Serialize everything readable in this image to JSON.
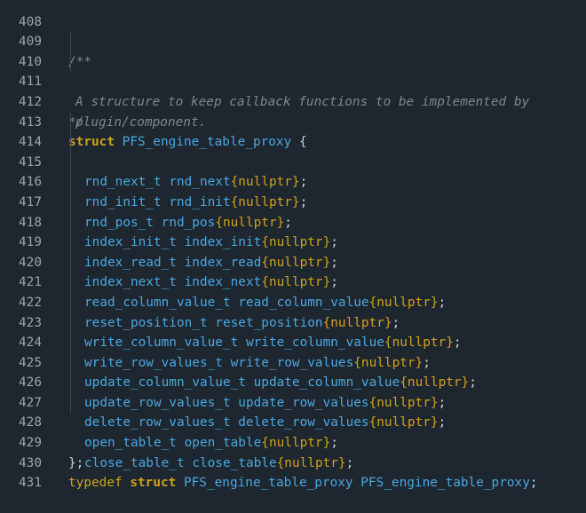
{
  "editor": {
    "lines": [
      {
        "n": "408",
        "kind": "empty"
      },
      {
        "n": "409",
        "kind": "comment",
        "text": "/**"
      },
      {
        "n": "410",
        "kind": "comment-body",
        "text": "A structure to keep callback functions to be implemented by"
      },
      {
        "n": "411",
        "kind": "comment-body",
        "text": "plugin/component."
      },
      {
        "n": "412",
        "kind": "comment",
        "text": "*/"
      },
      {
        "n": "413",
        "kind": "struct-open",
        "keyword": "struct",
        "name": "PFS_engine_table_proxy",
        "brace": "{"
      },
      {
        "n": "414",
        "kind": "member",
        "type": "rnd_next_t",
        "field": "rnd_next",
        "init": "{nullptr}"
      },
      {
        "n": "415",
        "kind": "member",
        "type": "rnd_init_t",
        "field": "rnd_init",
        "init": "{nullptr}"
      },
      {
        "n": "416",
        "kind": "member",
        "type": "rnd_pos_t",
        "field": "rnd_pos",
        "init": "{nullptr}"
      },
      {
        "n": "417",
        "kind": "member",
        "type": "index_init_t",
        "field": "index_init",
        "init": "{nullptr}"
      },
      {
        "n": "418",
        "kind": "member",
        "type": "index_read_t",
        "field": "index_read",
        "init": "{nullptr}"
      },
      {
        "n": "419",
        "kind": "member",
        "type": "index_next_t",
        "field": "index_next",
        "init": "{nullptr}"
      },
      {
        "n": "420",
        "kind": "member",
        "type": "read_column_value_t",
        "field": "read_column_value",
        "init": "{nullptr}"
      },
      {
        "n": "421",
        "kind": "member",
        "type": "reset_position_t",
        "field": "reset_position",
        "init": "{nullptr}"
      },
      {
        "n": "422",
        "kind": "member",
        "type": "write_column_value_t",
        "field": "write_column_value",
        "init": "{nullptr}"
      },
      {
        "n": "423",
        "kind": "member",
        "type": "write_row_values_t",
        "field": "write_row_values",
        "init": "{nullptr}"
      },
      {
        "n": "424",
        "kind": "member",
        "type": "update_column_value_t",
        "field": "update_column_value",
        "init": "{nullptr}"
      },
      {
        "n": "425",
        "kind": "member",
        "type": "update_row_values_t",
        "field": "update_row_values",
        "init": "{nullptr}"
      },
      {
        "n": "426",
        "kind": "member",
        "type": "delete_row_values_t",
        "field": "delete_row_values",
        "init": "{nullptr}"
      },
      {
        "n": "427",
        "kind": "member",
        "type": "open_table_t",
        "field": "open_table",
        "init": "{nullptr}"
      },
      {
        "n": "428",
        "kind": "member",
        "type": "close_table_t",
        "field": "close_table",
        "init": "{nullptr}"
      },
      {
        "n": "429",
        "kind": "struct-close",
        "text": "};"
      },
      {
        "n": "430",
        "kind": "typedef",
        "kw1": "typedef",
        "kw2": "struct",
        "name1": "PFS_engine_table_proxy",
        "name2": "PFS_engine_table_proxy",
        "semi": ";"
      },
      {
        "n": "431",
        "kind": "empty"
      }
    ]
  },
  "colors": {
    "background": "#1e2730",
    "line_number": "#9aa4ad",
    "comment": "#7d8790",
    "keyword": "#d0a21a",
    "identifier": "#4aa7e0",
    "text": "#c9d1d9"
  }
}
